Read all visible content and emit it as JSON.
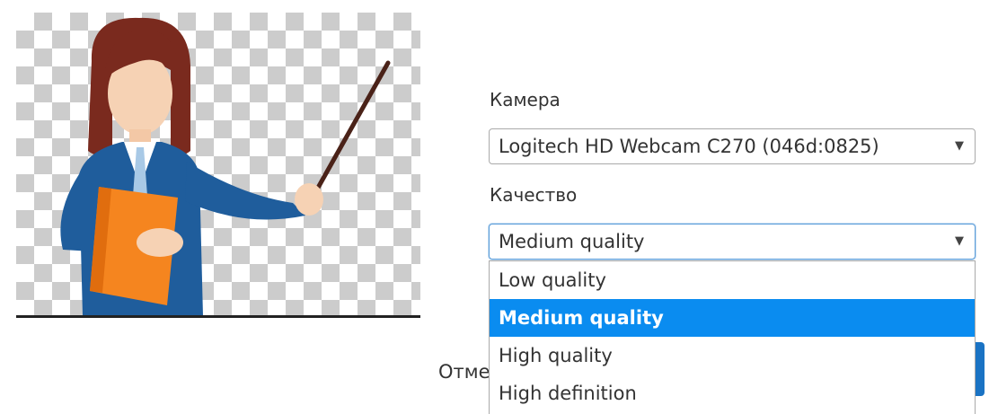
{
  "camera": {
    "label": "Камера",
    "selected": "Logitech HD Webcam C270 (046d:0825)"
  },
  "quality": {
    "label": "Качество",
    "selected": "Medium quality",
    "options": [
      "Low quality",
      "Medium quality",
      "High quality",
      "High definition"
    ],
    "highlighted_index": 1
  },
  "footer": {
    "cancel_label": "Отмена"
  },
  "icons": {
    "dropdown_arrow": "▼"
  },
  "colors": {
    "highlight": "#0a8cf0",
    "focus_border": "#5b9dd9",
    "primary_button": "#1a73c4"
  }
}
